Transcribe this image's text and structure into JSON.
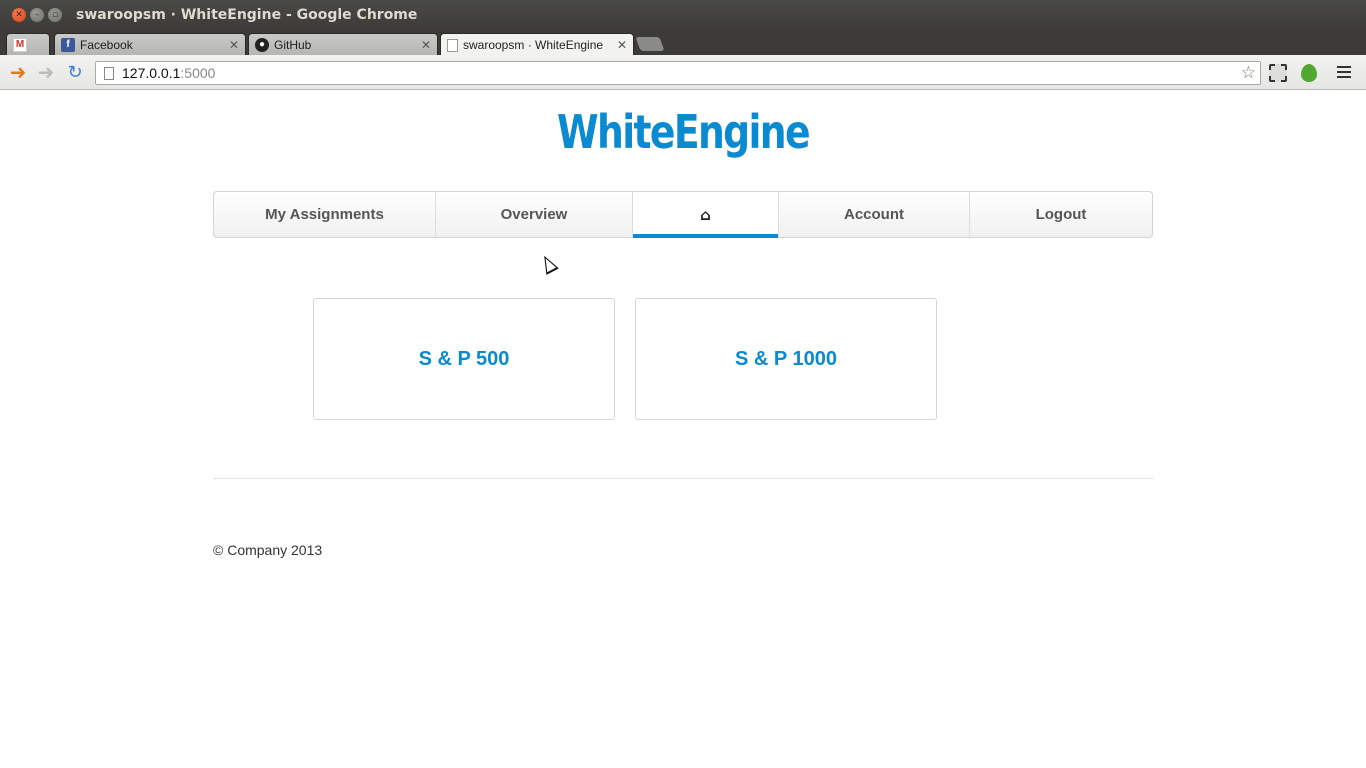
{
  "window": {
    "title": "swaroopsm · WhiteEngine - Google Chrome"
  },
  "tabs": [
    {
      "label": "",
      "icon": "gmail-icon"
    },
    {
      "label": "Facebook",
      "icon": "facebook-icon"
    },
    {
      "label": "GitHub",
      "icon": "github-icon"
    },
    {
      "label": "swaroopsm · WhiteEngine",
      "icon": "page-icon",
      "active": true
    }
  ],
  "toolbar": {
    "url_host": "127.0.0.1",
    "url_port": ":5000"
  },
  "site": {
    "brand": "WhiteEngine",
    "brand_color": "#0a8ad0",
    "nav": [
      {
        "label": "My Assignments"
      },
      {
        "label": "Overview"
      },
      {
        "label": "",
        "icon": "home-icon",
        "active": true
      },
      {
        "label": "Account"
      },
      {
        "label": "Logout"
      }
    ],
    "cards": [
      {
        "label": "S & P 500"
      },
      {
        "label": "S & P 1000"
      }
    ],
    "footer": "© Company 2013"
  }
}
